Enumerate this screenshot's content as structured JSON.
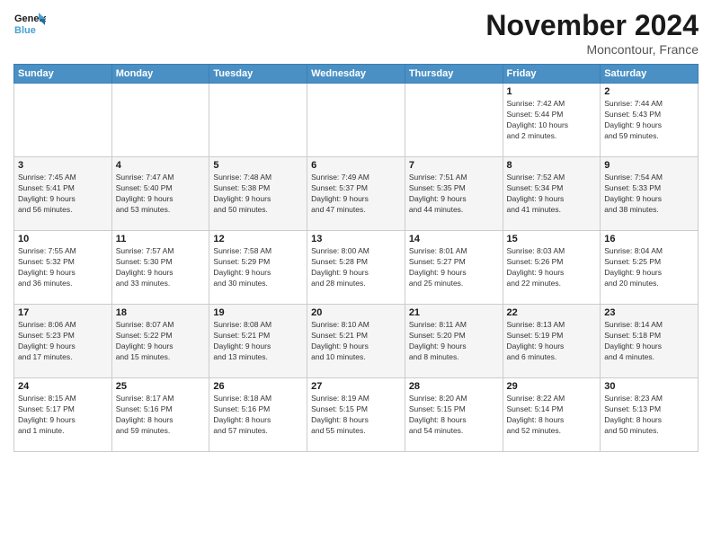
{
  "logo": {
    "line1": "General",
    "line2": "Blue"
  },
  "title": "November 2024",
  "location": "Moncontour, France",
  "days_header": [
    "Sunday",
    "Monday",
    "Tuesday",
    "Wednesday",
    "Thursday",
    "Friday",
    "Saturday"
  ],
  "weeks": [
    [
      {
        "day": "",
        "info": ""
      },
      {
        "day": "",
        "info": ""
      },
      {
        "day": "",
        "info": ""
      },
      {
        "day": "",
        "info": ""
      },
      {
        "day": "",
        "info": ""
      },
      {
        "day": "1",
        "info": "Sunrise: 7:42 AM\nSunset: 5:44 PM\nDaylight: 10 hours\nand 2 minutes."
      },
      {
        "day": "2",
        "info": "Sunrise: 7:44 AM\nSunset: 5:43 PM\nDaylight: 9 hours\nand 59 minutes."
      }
    ],
    [
      {
        "day": "3",
        "info": "Sunrise: 7:45 AM\nSunset: 5:41 PM\nDaylight: 9 hours\nand 56 minutes."
      },
      {
        "day": "4",
        "info": "Sunrise: 7:47 AM\nSunset: 5:40 PM\nDaylight: 9 hours\nand 53 minutes."
      },
      {
        "day": "5",
        "info": "Sunrise: 7:48 AM\nSunset: 5:38 PM\nDaylight: 9 hours\nand 50 minutes."
      },
      {
        "day": "6",
        "info": "Sunrise: 7:49 AM\nSunset: 5:37 PM\nDaylight: 9 hours\nand 47 minutes."
      },
      {
        "day": "7",
        "info": "Sunrise: 7:51 AM\nSunset: 5:35 PM\nDaylight: 9 hours\nand 44 minutes."
      },
      {
        "day": "8",
        "info": "Sunrise: 7:52 AM\nSunset: 5:34 PM\nDaylight: 9 hours\nand 41 minutes."
      },
      {
        "day": "9",
        "info": "Sunrise: 7:54 AM\nSunset: 5:33 PM\nDaylight: 9 hours\nand 38 minutes."
      }
    ],
    [
      {
        "day": "10",
        "info": "Sunrise: 7:55 AM\nSunset: 5:32 PM\nDaylight: 9 hours\nand 36 minutes."
      },
      {
        "day": "11",
        "info": "Sunrise: 7:57 AM\nSunset: 5:30 PM\nDaylight: 9 hours\nand 33 minutes."
      },
      {
        "day": "12",
        "info": "Sunrise: 7:58 AM\nSunset: 5:29 PM\nDaylight: 9 hours\nand 30 minutes."
      },
      {
        "day": "13",
        "info": "Sunrise: 8:00 AM\nSunset: 5:28 PM\nDaylight: 9 hours\nand 28 minutes."
      },
      {
        "day": "14",
        "info": "Sunrise: 8:01 AM\nSunset: 5:27 PM\nDaylight: 9 hours\nand 25 minutes."
      },
      {
        "day": "15",
        "info": "Sunrise: 8:03 AM\nSunset: 5:26 PM\nDaylight: 9 hours\nand 22 minutes."
      },
      {
        "day": "16",
        "info": "Sunrise: 8:04 AM\nSunset: 5:25 PM\nDaylight: 9 hours\nand 20 minutes."
      }
    ],
    [
      {
        "day": "17",
        "info": "Sunrise: 8:06 AM\nSunset: 5:23 PM\nDaylight: 9 hours\nand 17 minutes."
      },
      {
        "day": "18",
        "info": "Sunrise: 8:07 AM\nSunset: 5:22 PM\nDaylight: 9 hours\nand 15 minutes."
      },
      {
        "day": "19",
        "info": "Sunrise: 8:08 AM\nSunset: 5:21 PM\nDaylight: 9 hours\nand 13 minutes."
      },
      {
        "day": "20",
        "info": "Sunrise: 8:10 AM\nSunset: 5:21 PM\nDaylight: 9 hours\nand 10 minutes."
      },
      {
        "day": "21",
        "info": "Sunrise: 8:11 AM\nSunset: 5:20 PM\nDaylight: 9 hours\nand 8 minutes."
      },
      {
        "day": "22",
        "info": "Sunrise: 8:13 AM\nSunset: 5:19 PM\nDaylight: 9 hours\nand 6 minutes."
      },
      {
        "day": "23",
        "info": "Sunrise: 8:14 AM\nSunset: 5:18 PM\nDaylight: 9 hours\nand 4 minutes."
      }
    ],
    [
      {
        "day": "24",
        "info": "Sunrise: 8:15 AM\nSunset: 5:17 PM\nDaylight: 9 hours\nand 1 minute."
      },
      {
        "day": "25",
        "info": "Sunrise: 8:17 AM\nSunset: 5:16 PM\nDaylight: 8 hours\nand 59 minutes."
      },
      {
        "day": "26",
        "info": "Sunrise: 8:18 AM\nSunset: 5:16 PM\nDaylight: 8 hours\nand 57 minutes."
      },
      {
        "day": "27",
        "info": "Sunrise: 8:19 AM\nSunset: 5:15 PM\nDaylight: 8 hours\nand 55 minutes."
      },
      {
        "day": "28",
        "info": "Sunrise: 8:20 AM\nSunset: 5:15 PM\nDaylight: 8 hours\nand 54 minutes."
      },
      {
        "day": "29",
        "info": "Sunrise: 8:22 AM\nSunset: 5:14 PM\nDaylight: 8 hours\nand 52 minutes."
      },
      {
        "day": "30",
        "info": "Sunrise: 8:23 AM\nSunset: 5:13 PM\nDaylight: 8 hours\nand 50 minutes."
      }
    ]
  ]
}
